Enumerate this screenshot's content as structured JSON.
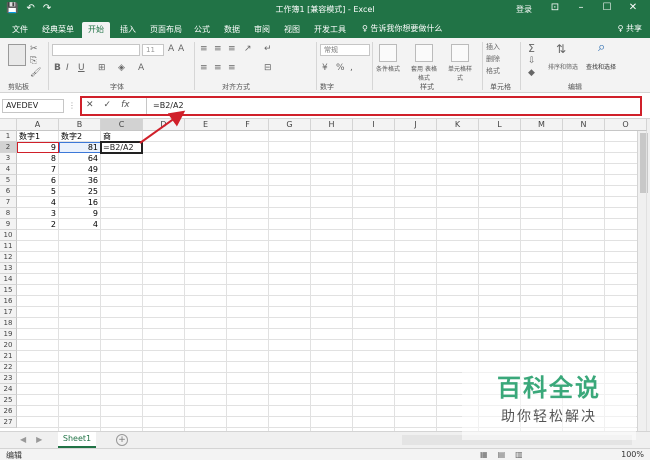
{
  "titlebar": {
    "title": "工作簿1 [兼容模式] - Excel",
    "login": "登录",
    "quick_access": [
      "💾",
      "↶",
      "↷"
    ],
    "window_buttons": [
      "⊡",
      "–",
      "☐",
      "✕"
    ]
  },
  "tabs": {
    "items": [
      "文件",
      "经典菜单",
      "开始",
      "插入",
      "页面布局",
      "公式",
      "数据",
      "审阅",
      "视图",
      "开发工具"
    ],
    "active": "开始",
    "tell_me": "♀ 告诉我你想要做什么",
    "share": "♀ 共享"
  },
  "ribbon": {
    "groups": [
      "剪贴板",
      "字体",
      "对齐方式",
      "数字",
      "样式",
      "单元格",
      "编辑"
    ],
    "font_size": "11",
    "number_format": "常规",
    "style_buttons": [
      "条件格式",
      "套用\n表格格式",
      "单元格样式"
    ],
    "cell_buttons": [
      "插入",
      "删除",
      "格式"
    ],
    "edit_buttons": [
      "排序和筛选",
      "查找和选择"
    ]
  },
  "formula_bar": {
    "name_box": "AVEDEV",
    "cancel": "✕",
    "enter": "✓",
    "fx": "fx",
    "formula": "=B2/A2"
  },
  "grid": {
    "columns": [
      "A",
      "B",
      "C",
      "D",
      "E",
      "F",
      "G",
      "H",
      "I",
      "J",
      "K",
      "L",
      "M",
      "N",
      "O"
    ],
    "rows": [
      "1",
      "2",
      "3",
      "4",
      "5",
      "6",
      "7",
      "8",
      "9",
      "10",
      "11",
      "12",
      "13",
      "14",
      "15",
      "16",
      "17",
      "18",
      "19",
      "20",
      "21",
      "22",
      "23",
      "24",
      "25",
      "26",
      "27"
    ],
    "header_row": [
      "数字1",
      "数字2",
      "商"
    ],
    "data": [
      {
        "a": "9",
        "b": "81"
      },
      {
        "a": "8",
        "b": "64"
      },
      {
        "a": "7",
        "b": "49"
      },
      {
        "a": "6",
        "b": "36"
      },
      {
        "a": "5",
        "b": "25"
      },
      {
        "a": "4",
        "b": "16"
      },
      {
        "a": "3",
        "b": "9"
      },
      {
        "a": "2",
        "b": "4"
      }
    ],
    "editing_cell": "=B2/A2"
  },
  "sheets": {
    "tabs": [
      "Sheet1"
    ],
    "add": "+"
  },
  "status": {
    "mode": "编辑",
    "zoom": "100%"
  },
  "watermark": {
    "title": "百科全说",
    "subtitle": "助你轻松解决"
  },
  "colors": {
    "excel_green": "#217346",
    "annotation_red": "#d0202a"
  }
}
